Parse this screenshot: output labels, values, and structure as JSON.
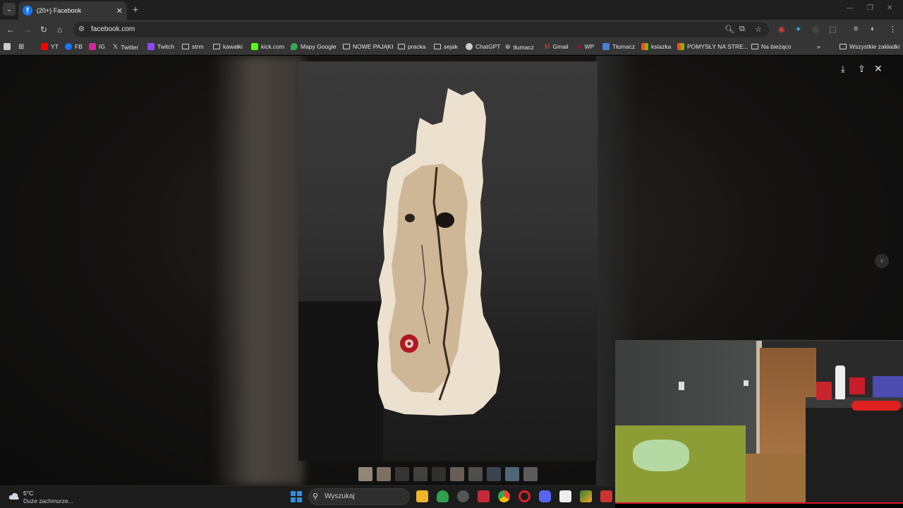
{
  "browser": {
    "tab_title": "(20+) Facebook",
    "url": "facebook.com"
  },
  "bookmarks": [
    {
      "label": "YT",
      "icon": "youtube-icon"
    },
    {
      "label": "FB",
      "icon": "facebook-icon"
    },
    {
      "label": "IG",
      "icon": "instagram-icon"
    },
    {
      "label": "Twitter",
      "icon": "x-icon"
    },
    {
      "label": "Twitch",
      "icon": "twitch-icon"
    },
    {
      "label": "strm",
      "icon": "folder-icon"
    },
    {
      "label": "kawałki",
      "icon": "folder-icon"
    },
    {
      "label": "kick.com",
      "icon": "kick-icon"
    },
    {
      "label": "Mapy Google",
      "icon": "maps-icon"
    },
    {
      "label": "NOWE PAJĄKI",
      "icon": "folder-icon"
    },
    {
      "label": "pracka",
      "icon": "folder-icon"
    },
    {
      "label": "sejak",
      "icon": "folder-icon"
    },
    {
      "label": "ChatGPT",
      "icon": "chatgpt-icon"
    },
    {
      "label": "tłumacz",
      "icon": "translate-icon"
    },
    {
      "label": "Gmail",
      "icon": "gmail-icon"
    },
    {
      "label": "WP",
      "icon": "wp-icon"
    },
    {
      "label": "Tłumacz",
      "icon": "translate-icon"
    },
    {
      "label": "ksiazka",
      "icon": "microsoft-icon"
    },
    {
      "label": "POMYSŁY NA STRE...",
      "icon": "microsoft-icon"
    },
    {
      "label": "Na bieżąco",
      "icon": "folder-icon"
    }
  ],
  "all_bookmarks": "Wszystkie zakładki",
  "taskbar": {
    "weather_temp": "5°C",
    "weather_desc": "Duże zachmurze...",
    "search_label": "Wyszukaj"
  },
  "colors": {
    "accent": "#1877f2",
    "windows_blue": "#2b8fe8",
    "stream_red": "#d2142a"
  }
}
